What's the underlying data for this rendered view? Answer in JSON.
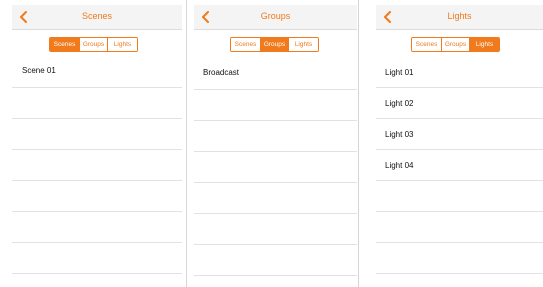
{
  "accent_color": "#f07a1c",
  "icons": {
    "back": "chevron-left-icon"
  },
  "segments": {
    "scenes": "Scenes",
    "groups": "Groups",
    "lights": "Lights"
  },
  "scenes_screen": {
    "title": "Scenes",
    "selected_segment": "Scenes",
    "items": [
      "Scene 01"
    ]
  },
  "groups_screen": {
    "title": "Groups",
    "selected_segment": "Groups",
    "items": [
      "Broadcast"
    ]
  },
  "lights_screen": {
    "title": "Lights",
    "selected_segment": "Lights",
    "items": [
      "Light 01",
      "Light 02",
      "Light 03",
      "Light 04"
    ]
  }
}
